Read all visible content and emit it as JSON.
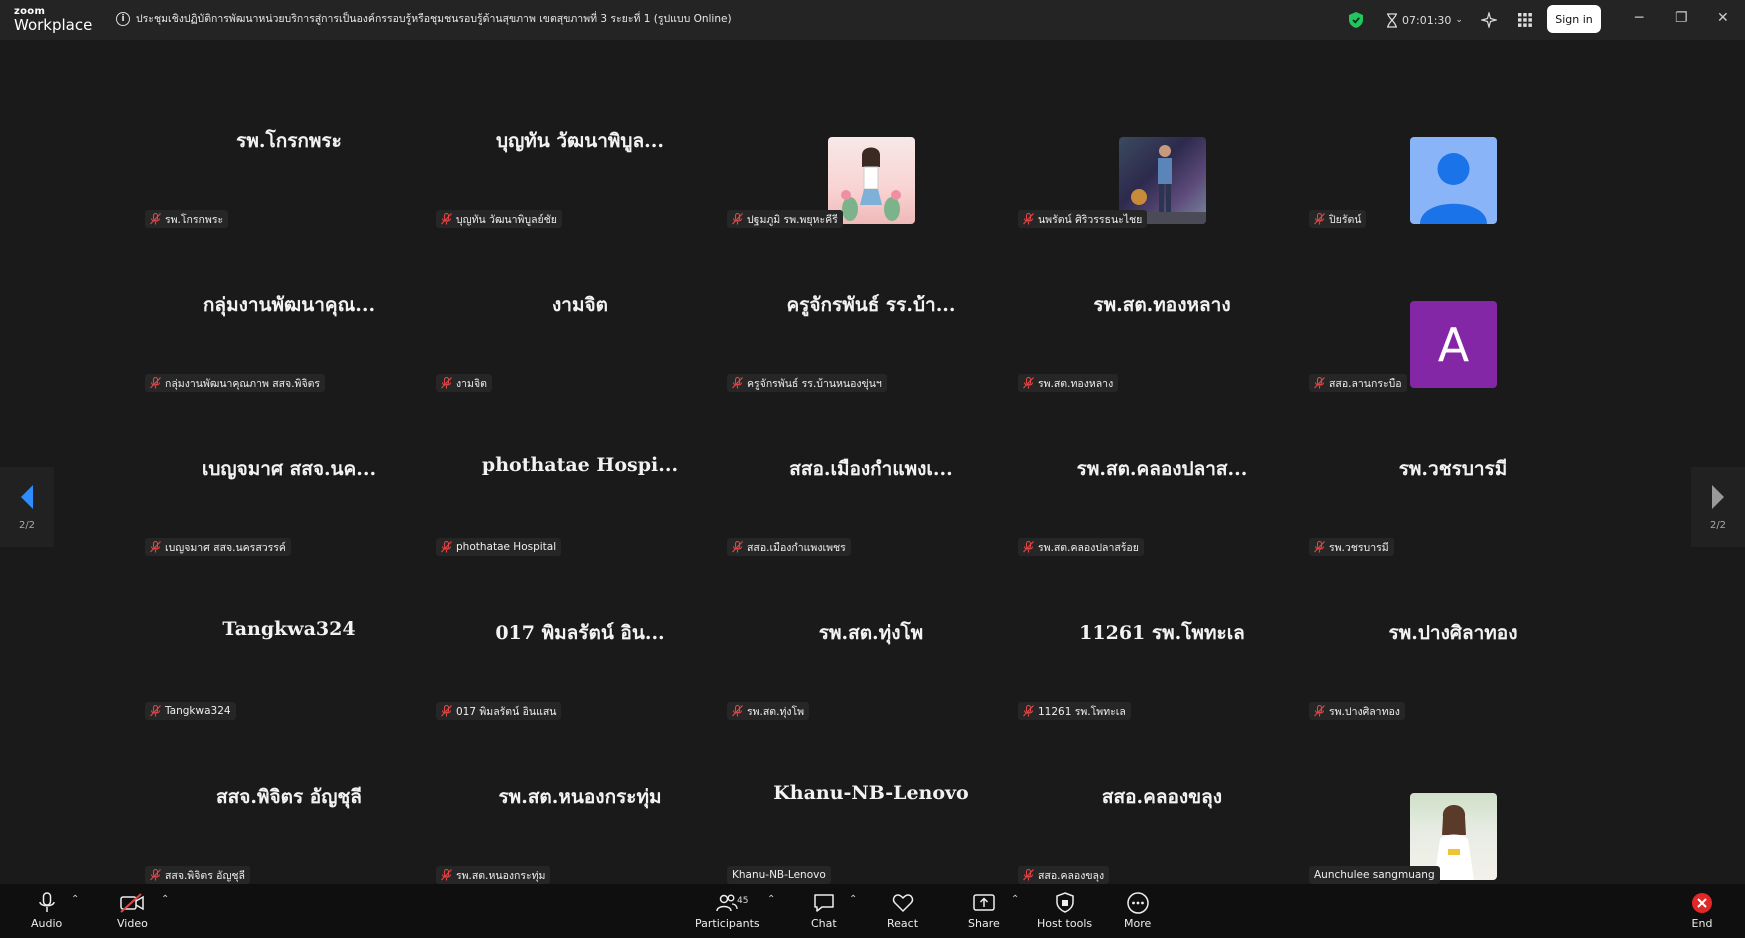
{
  "app": {
    "logo_top": "zoom",
    "logo_bottom": "Workplace"
  },
  "meeting": {
    "title": "ประชุมเชิงปฏิบัติการพัฒนาหน่วยบริการสู่การเป็นองค์กรรอบรู้หรือชุมชนรอบรู้ด้านสุขภาพ เขตสุขภาพที่ 3 ระยะที่ 1 (รูปแบบ Online)",
    "timer": "07:01:30",
    "signin": "Sign in"
  },
  "pager": {
    "left": "2/2",
    "right": "2/2"
  },
  "tiles": [
    {
      "big": "รพ.โกรกพระ",
      "tag": "รพ.โกรกพระ"
    },
    {
      "big": "บุญทัน วัฒนาพิบูล...",
      "tag": "บุญทัน วัฒนาพิบูลย์ชัย"
    },
    {
      "big": "",
      "tag": "ปฐมภูมิ รพ.พยุหะคีรี",
      "avatar": "photo-girl-illustration"
    },
    {
      "big": "",
      "tag": "นพรัตน์ ศิริวรรธนะไชย",
      "avatar": "photo-person-street"
    },
    {
      "big": "",
      "tag": "ปิยรัตน์",
      "avatar": "default-person"
    },
    {
      "big": "กลุ่มงานพัฒนาคุณ...",
      "tag": "กลุ่มงานพัฒนาคุณภาพ สสจ.พิจิตร"
    },
    {
      "big": "งามจิต",
      "tag": "งามจิต"
    },
    {
      "big": "ครูจักรพันธ์ รร.บ้า...",
      "tag": "ครูจักรพันธ์ รร.บ้านหนองขุ่นฯ"
    },
    {
      "big": "รพ.สต.ทองหลาง",
      "tag": "รพ.สต.ทองหลาง"
    },
    {
      "big": "",
      "tag": "สสอ.ลานกระบือ",
      "avatar": "letter",
      "letter": "A"
    },
    {
      "big": "เบญจมาศ สสจ.นค...",
      "tag": "เบญจมาศ สสจ.นครสวรรค์"
    },
    {
      "big": "phothatae Hospi...",
      "tag": "phothatae Hospital"
    },
    {
      "big": "สสอ.เมืองกำแพงเ...",
      "tag": "สสอ.เมืองกำแพงเพชร"
    },
    {
      "big": "รพ.สต.คลองปลาส...",
      "tag": "รพ.สต.คลองปลาสร้อย"
    },
    {
      "big": "รพ.วชรบารมี",
      "tag": "รพ.วชรบารมี"
    },
    {
      "big": "Tangkwa324",
      "tag": "Tangkwa324"
    },
    {
      "big": "017 พิมลรัตน์ อิน...",
      "tag": "017 พิมลรัตน์ อินแสน"
    },
    {
      "big": "รพ.สต.ทุ่งโพ",
      "tag": "รพ.สต.ทุ่งโพ"
    },
    {
      "big": "11261 รพ.โพทะเล",
      "tag": "11261 รพ.โพทะเล"
    },
    {
      "big": "รพ.ปางศิลาทอง",
      "tag": "รพ.ปางศิลาทอง"
    },
    {
      "big": "สสจ.พิจิตร อัญชุลี",
      "tag": "สสจ.พิจิตร อัญชุลี"
    },
    {
      "big": "รพ.สต.หนองกระทุ่ม",
      "tag": "รพ.สต.หนองกระทุ่ม"
    },
    {
      "big": "Khanu-NB-Lenovo",
      "tag": "Khanu-NB-Lenovo",
      "unmuted": true
    },
    {
      "big": "สสอ.คลองขลุง",
      "tag": "สสอ.คลองขลุง"
    },
    {
      "big": "",
      "tag": "Aunchulee sangmuang",
      "avatar": "photo-woman-outdoor",
      "unmuted": true
    }
  ],
  "toolbar": {
    "audio": "Audio",
    "video": "Video",
    "participants": "Participants",
    "participants_count": "45",
    "chat": "Chat",
    "react": "React",
    "share": "Share",
    "host_tools": "Host tools",
    "more": "More",
    "end": "End"
  },
  "colors": {
    "accent": "#0e72ed",
    "end": "#e02828",
    "shield": "#22c55e",
    "mute": "#e04646"
  }
}
